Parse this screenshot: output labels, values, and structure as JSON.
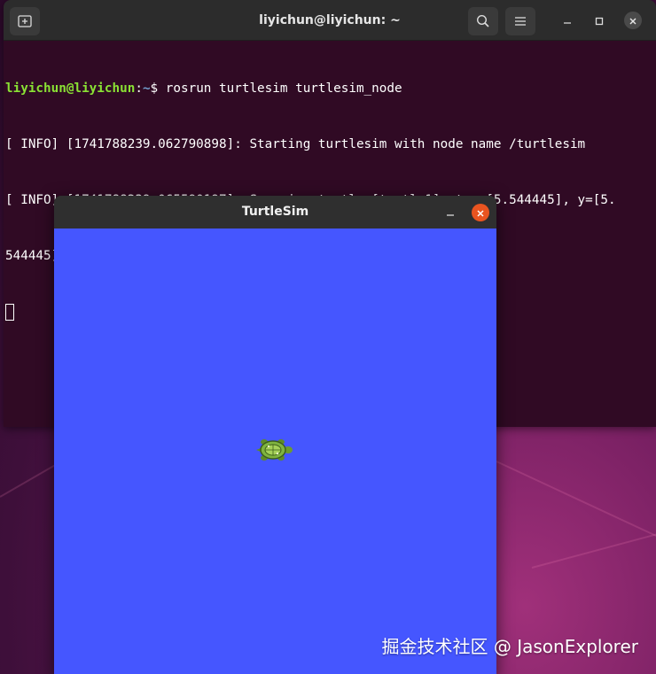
{
  "terminal": {
    "title": "liyichun@liyichun: ~",
    "prompt_user": "liyichun@liyichun",
    "prompt_sep": ":",
    "prompt_path": "~",
    "prompt_symbol": "$ ",
    "command": "rosrun turtlesim turtlesim_node",
    "output": [
      "[ INFO] [1741788239.062790898]: Starting turtlesim with node name /turtlesim",
      "[ INFO] [1741788239.065590197]: Spawning turtle [turtle1] at x=[5.544445], y=[5.",
      "544445], theta=[0.000000]"
    ],
    "icons": {
      "new_tab": "new-tab-icon",
      "search": "search-icon",
      "menu": "hamburger-menu-icon",
      "minimize": "minimize-icon",
      "maximize": "maximize-icon",
      "close": "close-icon"
    }
  },
  "turtlesim": {
    "title": "TurtleSim",
    "background_color": "#4556ff",
    "icons": {
      "minimize": "minimize-icon",
      "close": "close-icon",
      "turtle": "turtle-icon"
    }
  },
  "watermark": "掘金技术社区 @ JasonExplorer",
  "colors": {
    "terminal_bg": "#300a24",
    "prompt_user": "#8ae234",
    "prompt_path": "#729fcf",
    "close_accent": "#e95420"
  }
}
